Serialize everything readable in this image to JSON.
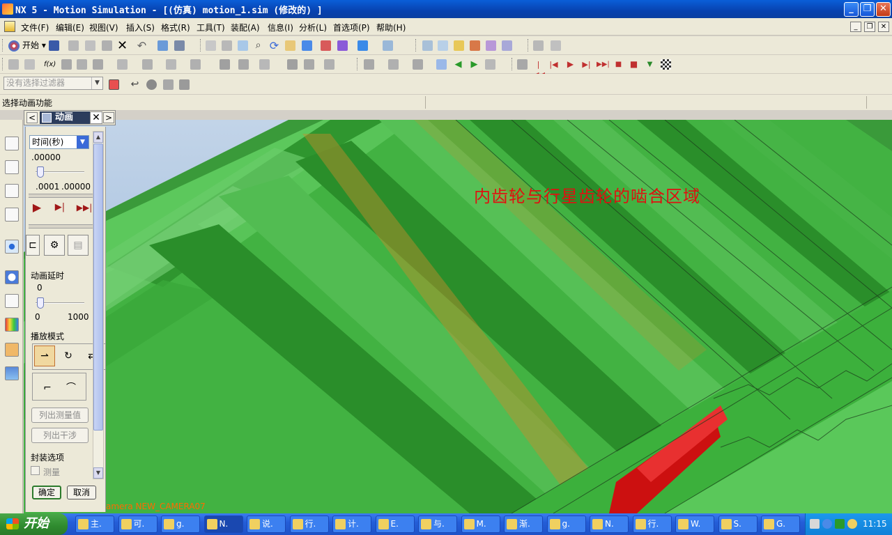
{
  "window": {
    "title": "NX 5 - Motion Simulation - [(仿真) motion_1.sim  (修改的) ]",
    "minimize": "_",
    "restore": "❐",
    "close": "✕"
  },
  "menu": {
    "items": [
      "文件(F)",
      "编辑(E)",
      "视图(V)",
      "插入(S)",
      "格式(R)",
      "工具(T)",
      "装配(A)",
      "信息(I)",
      "分析(L)",
      "首选项(P)",
      "帮助(H)"
    ]
  },
  "toolbar": {
    "start_label": "开始",
    "selection_filter_placeholder": "没有选择过滤器"
  },
  "prompt": {
    "text": "选择动画功能"
  },
  "animation_dialog": {
    "title": "动画",
    "prev": "<",
    "next": ">",
    "close": "✕",
    "time_mode": "时间(秒)",
    "current_time": ".00000",
    "time_min": ".0001",
    "time_max": ".00000",
    "time_slider_fraction": 0.0,
    "play": "▶",
    "step": "▶|",
    "fast_forward": "▶▶|",
    "delay_label": "动画延时",
    "delay_value": "0",
    "delay_min": "0",
    "delay_max": "1000",
    "delay_slider_fraction": 0.0,
    "playback_mode_label": "播放模式",
    "list_measures_button": "列出测量值",
    "list_interference_button": "列出干涉",
    "envelope_label": "封装选项",
    "measure_checkbox_label": "测量",
    "ok_button": "确定",
    "cancel_button": "取消"
  },
  "viewport": {
    "annotation": "内齿轮与行星齿轮的啮合区域",
    "camera_label": "amera NEW_CAMERA07"
  },
  "taskbar": {
    "start_label": "开始",
    "items": [
      "主.",
      "可.",
      "g.",
      "N.",
      "说.",
      "行.",
      "计.",
      "E.",
      "与.",
      "M.",
      "渐.",
      "g.",
      "N.",
      "行.",
      "W.",
      "S.",
      "G."
    ],
    "active_index": 3,
    "clock": "11:15"
  },
  "colors": {
    "gear_green": "#3fb43f",
    "gear_dark_green": "#1d7a1d",
    "contact_red": "#cc1010",
    "annotation_red": "#e01010",
    "titlebar_blue": "#0842b0"
  }
}
